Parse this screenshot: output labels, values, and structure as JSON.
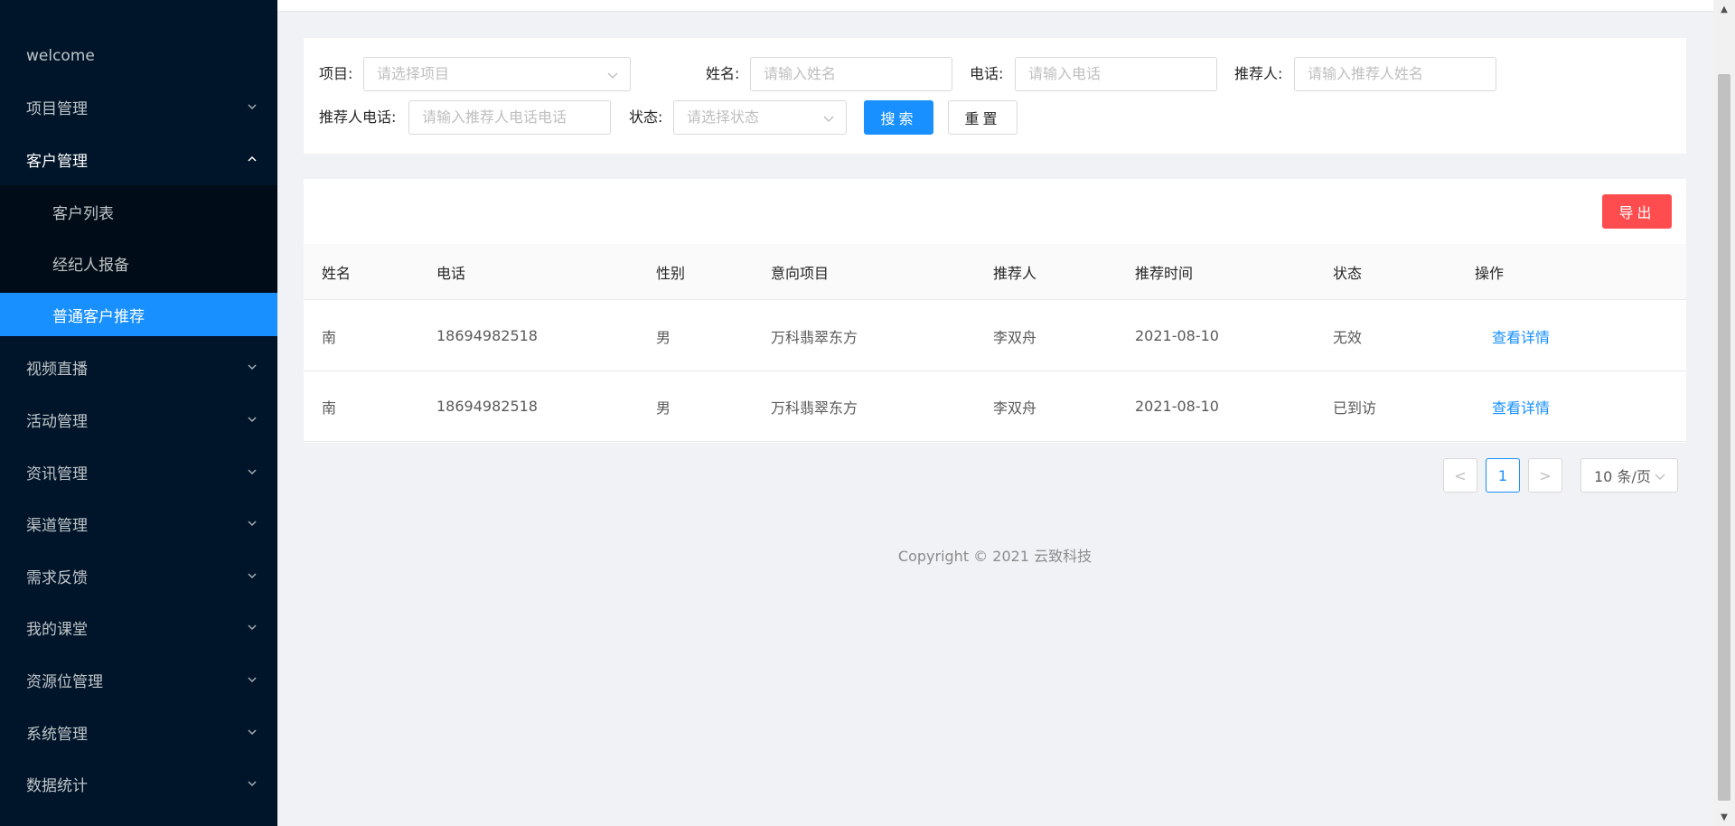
{
  "sidebar": {
    "items": [
      {
        "label": "welcome",
        "has_chevron": false
      },
      {
        "label": "项目管理",
        "has_chevron": true
      },
      {
        "label": "客户管理",
        "has_chevron": true,
        "open": true
      },
      {
        "label": "视频直播",
        "has_chevron": true
      },
      {
        "label": "活动管理",
        "has_chevron": true
      },
      {
        "label": "资讯管理",
        "has_chevron": true
      },
      {
        "label": "渠道管理",
        "has_chevron": true
      },
      {
        "label": "需求反馈",
        "has_chevron": true
      },
      {
        "label": "我的课堂",
        "has_chevron": true
      },
      {
        "label": "资源位管理",
        "has_chevron": true
      },
      {
        "label": "系统管理",
        "has_chevron": true
      },
      {
        "label": "数据统计",
        "has_chevron": true
      }
    ],
    "sub_items": [
      {
        "label": "客户列表"
      },
      {
        "label": "经纪人报备"
      },
      {
        "label": "普通客户推荐",
        "active": true
      }
    ]
  },
  "filters": {
    "project_label": "项目:",
    "project_placeholder": "请选择项目",
    "name_label": "姓名:",
    "name_placeholder": "请输入姓名",
    "phone_label": "电话:",
    "phone_placeholder": "请输入电话",
    "referrer_label": "推荐人:",
    "referrer_placeholder": "请输入推荐人姓名",
    "referrer_phone_label": "推荐人电话:",
    "referrer_phone_placeholder": "请输入推荐人电话电话",
    "status_label": "状态:",
    "status_placeholder": "请选择状态",
    "search_button": "搜索",
    "reset_button": "重置"
  },
  "table": {
    "export_button": "导出",
    "columns": [
      "姓名",
      "电话",
      "性别",
      "意向项目",
      "推荐人",
      "推荐时间",
      "状态",
      "操作"
    ],
    "rows": [
      [
        "南",
        "18694982518",
        "男",
        "万科翡翠东方",
        "李双舟",
        "2021-08-10",
        "无效",
        "查看详情"
      ],
      [
        "南",
        "18694982518",
        "男",
        "万科翡翠东方",
        "李双舟",
        "2021-08-10",
        "已到访",
        "查看详情"
      ]
    ]
  },
  "pagination": {
    "prev": "<",
    "current": "1",
    "next": ">",
    "page_size": "10 条/页"
  },
  "footer": {
    "copyright": "Copyright © 2021 云致科技"
  },
  "colors": {
    "sidebar_bg": "#001529",
    "submenu_bg": "#000c17",
    "primary": "#1890ff",
    "danger": "#ff4d4f"
  }
}
